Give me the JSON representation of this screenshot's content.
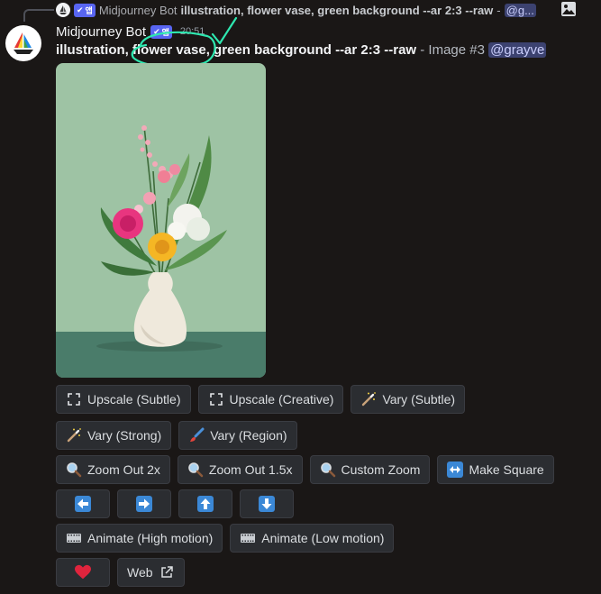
{
  "reply": {
    "author": "Midjourney Bot",
    "badge": "앱",
    "text": "illustration, flower vase, green background --ar 2:3 --raw",
    "separator": "-",
    "mention": "@g..."
  },
  "message": {
    "author": "Midjourney Bot",
    "badge": "앱",
    "timestamp": "20:51",
    "prompt": "illustration, flower vase, green background --ar 2:3 --raw",
    "suffix": " - Image #3 ",
    "mention": "@grayve"
  },
  "buttons": {
    "upscale_subtle": "Upscale (Subtle)",
    "upscale_creative": "Upscale (Creative)",
    "vary_subtle": "Vary (Subtle)",
    "vary_strong": "Vary (Strong)",
    "vary_region": "Vary (Region)",
    "zoom_out_2x": "Zoom Out 2x",
    "zoom_out_1_5x": "Zoom Out 1.5x",
    "custom_zoom": "Custom Zoom",
    "make_square": "Make Square",
    "animate_high": "Animate (High motion)",
    "animate_low": "Animate (Low motion)",
    "web": "Web"
  },
  "colors": {
    "background": "#1a1716",
    "button": "#2b2d31",
    "badge": "#5865f2",
    "annotation": "#2ee8b0",
    "image_bg": "#9ec3a4",
    "table": "#4a7c6a"
  }
}
